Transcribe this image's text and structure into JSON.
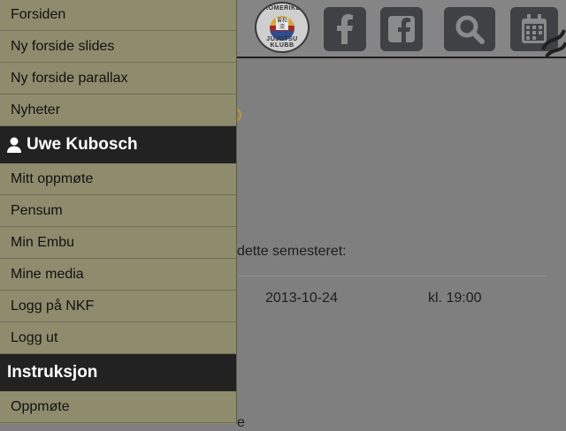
{
  "header": {
    "logo_text_top": "ROMERIKE",
    "logo_text_bottom": "JUJUTSU KLUBB",
    "logo_kanji": "曾和流",
    "buttons": [
      {
        "name": "facebook",
        "icon": "facebook-icon"
      },
      {
        "name": "facebook-page",
        "icon": "facebook-square-icon"
      },
      {
        "name": "search",
        "icon": "search-icon"
      },
      {
        "name": "calendar",
        "icon": "calendar-icon"
      }
    ]
  },
  "content": {
    "semester_text": "dette semesteret:",
    "date": "2013-10-24",
    "time": "kl. 19:00",
    "tail": "e"
  },
  "menu": {
    "items_top": [
      "Forsiden",
      "Ny forside slides",
      "Ny forside parallax",
      "Nyheter"
    ],
    "user_header": "Uwe Kubosch",
    "user_items": [
      "Mitt oppmøte",
      "Pensum",
      "Min Embu",
      "Mine media",
      "Logg på NKF",
      "Logg ut"
    ],
    "section_header": "Instruksjon",
    "section_items": [
      "Oppmøte"
    ]
  },
  "colors": {
    "menu_bg": "#8e8c6d",
    "menu_header_bg": "#222222",
    "icon_button_bg": "#3f4145"
  }
}
